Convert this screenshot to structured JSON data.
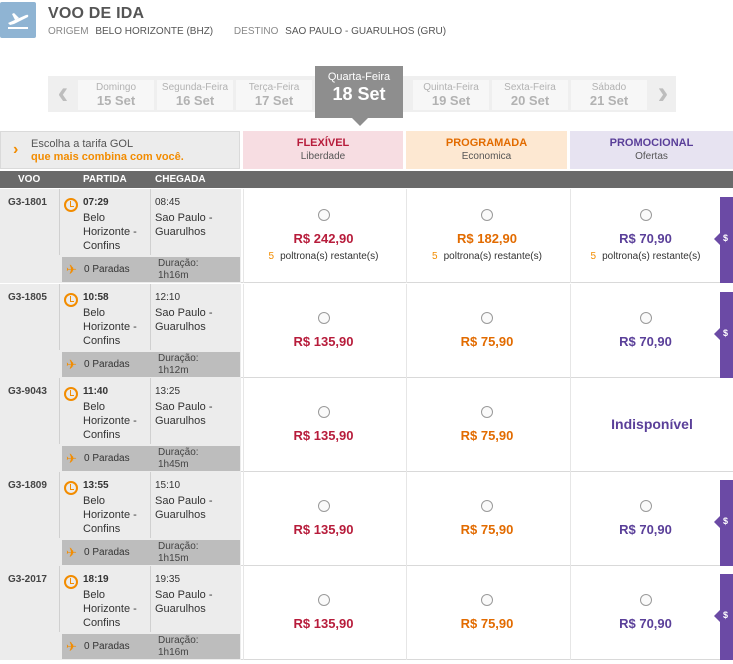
{
  "header": {
    "icon": "plane-departure-icon",
    "title": "VOO DE IDA",
    "origin_label": "ORIGEM",
    "origin_value": "BELO HORIZONTE (BHZ)",
    "destination_label": "DESTINO",
    "destination_value": "SAO PAULO - GUARULHOS (GRU)"
  },
  "dates": {
    "prev_icon": "‹",
    "next_icon": "›",
    "days": [
      {
        "name": "Domingo",
        "num": "15 Set"
      },
      {
        "name": "Segunda-Feira",
        "num": "16 Set"
      },
      {
        "name": "Terça-Feira",
        "num": "17 Set"
      },
      {
        "name": "Quinta-Feira",
        "num": "19 Set"
      },
      {
        "name": "Sexta-Feira",
        "num": "20 Set"
      },
      {
        "name": "Sábado",
        "num": "21 Set"
      }
    ],
    "active": {
      "name": "Quarta-Feira",
      "num": "18 Set"
    }
  },
  "choose": {
    "line1": "Escolha a tarifa GOL",
    "line2": "que mais combina com você."
  },
  "fares": {
    "flex": {
      "name": "FLEXÍVEL",
      "sub": "Liberdade",
      "color": "#b71c3b"
    },
    "prog": {
      "name": "PROGRAMADA",
      "sub": "Economica",
      "color": "#e26b00"
    },
    "promo": {
      "name": "PROMOCIONAL",
      "sub": "Ofertas",
      "color": "#5a3f99"
    }
  },
  "columns": {
    "voo": "VOO",
    "partida": "PARTIDA",
    "chegada": "CHEGADA"
  },
  "flights": [
    {
      "number": "G3-1801",
      "dep_time": "07:29",
      "dep_city": "Belo Horizonte - Confins",
      "arr_time": "08:45",
      "arr_city": "Sao Paulo - Guarulhos",
      "stops": "0 Paradas",
      "duration_label": "Duração:",
      "duration": "1h16m",
      "flex_price": "R$ 242,90",
      "prog_price": "R$ 182,90",
      "promo_price": "R$ 70,90",
      "seats_num": "5",
      "seats_text": "poltrona(s) restante(s)",
      "promo_tag": "$"
    },
    {
      "number": "G3-1805",
      "dep_time": "10:58",
      "dep_city": "Belo Horizonte - Confins",
      "arr_time": "12:10",
      "arr_city": "Sao Paulo - Guarulhos",
      "stops": "0 Paradas",
      "duration_label": "Duração:",
      "duration": "1h12m",
      "flex_price": "R$ 135,90",
      "prog_price": "R$ 75,90",
      "promo_price": "R$ 70,90",
      "promo_tag": "$"
    },
    {
      "number": "G3-9043",
      "dep_time": "11:40",
      "dep_city": "Belo Horizonte - Confins",
      "arr_time": "13:25",
      "arr_city": "Sao Paulo - Guarulhos",
      "stops": "0 Paradas",
      "duration_label": "Duração:",
      "duration": "1h45m",
      "flex_price": "R$ 135,90",
      "prog_price": "R$ 75,90",
      "promo_unavailable": "Indisponível"
    },
    {
      "number": "G3-1809",
      "dep_time": "13:55",
      "dep_city": "Belo Horizonte - Confins",
      "arr_time": "15:10",
      "arr_city": "Sao Paulo - Guarulhos",
      "stops": "0 Paradas",
      "duration_label": "Duração:",
      "duration": "1h15m",
      "flex_price": "R$ 135,90",
      "prog_price": "R$ 75,90",
      "promo_price": "R$ 70,90",
      "promo_tag": "$"
    },
    {
      "number": "G3-2017",
      "dep_time": "18:19",
      "dep_city": "Belo Horizonte - Confins",
      "arr_time": "19:35",
      "arr_city": "Sao Paulo - Guarulhos",
      "stops": "0 Paradas",
      "duration_label": "Duração:",
      "duration": "1h16m",
      "flex_price": "R$ 135,90",
      "prog_price": "R$ 75,90",
      "promo_price": "R$ 70,90",
      "promo_tag": "$"
    }
  ]
}
